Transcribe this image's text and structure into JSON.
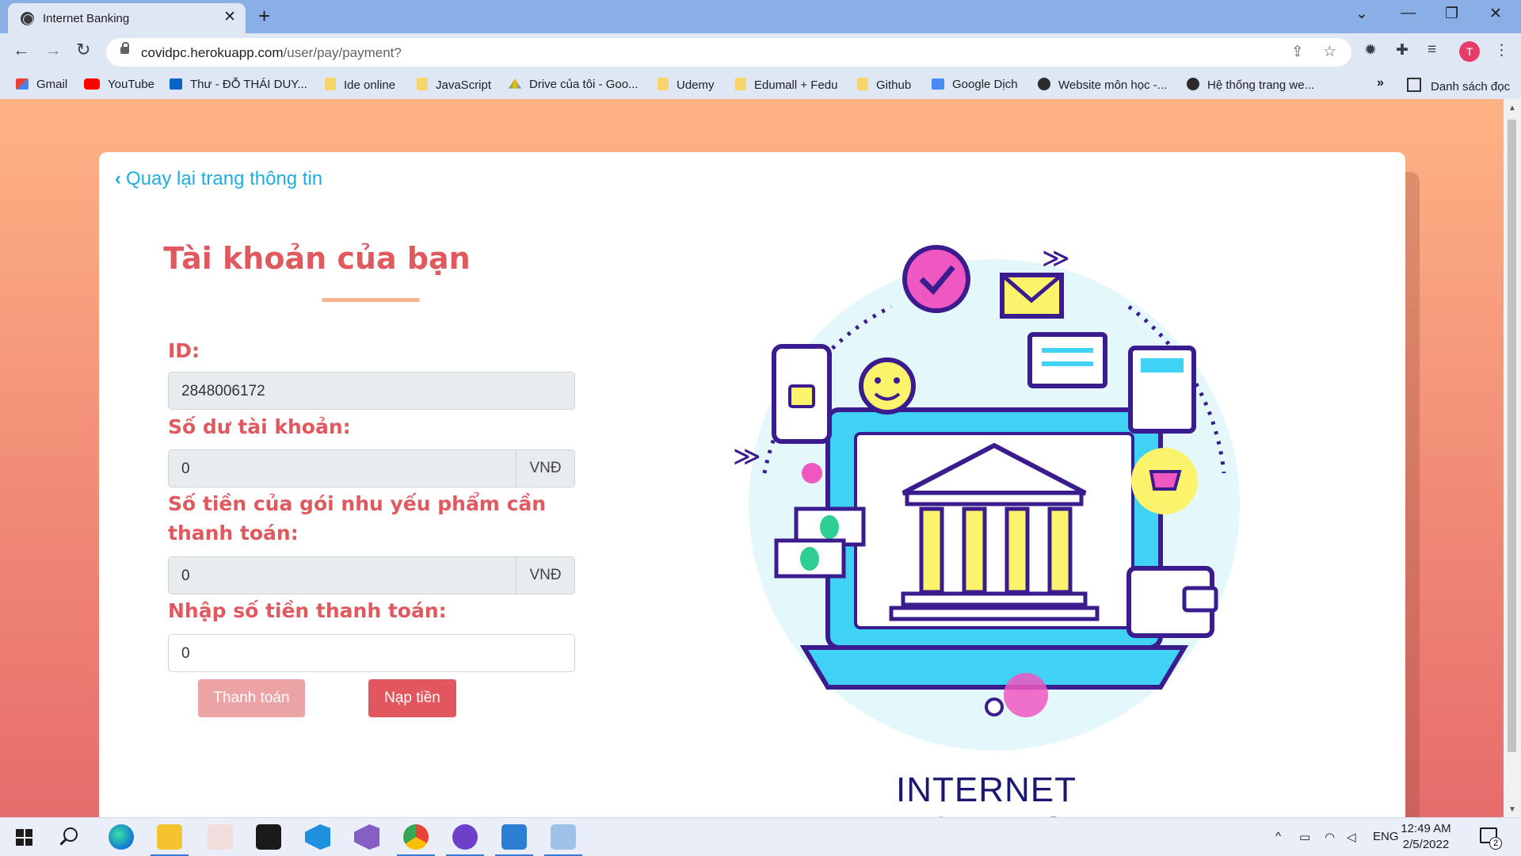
{
  "browser": {
    "tab_title": "Internet Banking",
    "url_host": "covidpc.herokuapp.com",
    "url_path": "/user/pay/payment?",
    "profile_initial": "T",
    "bookmarks": [
      {
        "label": "Gmail",
        "icon": "gmail-icon"
      },
      {
        "label": "YouTube",
        "icon": "youtube-icon"
      },
      {
        "label": "Thư - ĐỖ THÁI DUY...",
        "icon": "outlook-icon"
      },
      {
        "label": "Ide online",
        "icon": "folder-icon"
      },
      {
        "label": "JavaScript",
        "icon": "folder-icon"
      },
      {
        "label": "Drive của tôi - Goo...",
        "icon": "drive-icon"
      },
      {
        "label": "Udemy",
        "icon": "folder-icon"
      },
      {
        "label": "Edumall + Fedu",
        "icon": "folder-icon"
      },
      {
        "label": "Github",
        "icon": "folder-icon"
      },
      {
        "label": "Google Dịch",
        "icon": "google-translate-icon"
      },
      {
        "label": "Website môn học -...",
        "icon": "globe-icon"
      },
      {
        "label": "Hệ thống trang we...",
        "icon": "globe-icon"
      }
    ],
    "bookmarks_more": "»",
    "reading_list": "Danh sách đọc"
  },
  "page": {
    "back_link": "Quay lại trang thông tin",
    "title": "Tài khoản của bạn",
    "id_label": "ID:",
    "id_value": "2848006172",
    "balance_label": "Số dư tài khoản:",
    "balance_value": "0",
    "currency": "VNĐ",
    "package_label": "Số tiền của gói nhu yếu phẩm cần thanh toán:",
    "package_value": "0",
    "payment_label": "Nhập số tiền thanh toán:",
    "payment_value": "0",
    "pay_button": "Thanh toán",
    "topup_button": "Nạp tiền",
    "illustration_caption": "INTERNET BANKING"
  },
  "colors": {
    "accent_red": "#e0595f",
    "link_blue": "#1eaee0",
    "page_gradient_top": "#ffb385",
    "page_gradient_bottom": "#e76c6c"
  },
  "taskbar": {
    "language": "ENG",
    "time": "12:49 AM",
    "date": "2/5/2022",
    "notification_count": "2"
  }
}
